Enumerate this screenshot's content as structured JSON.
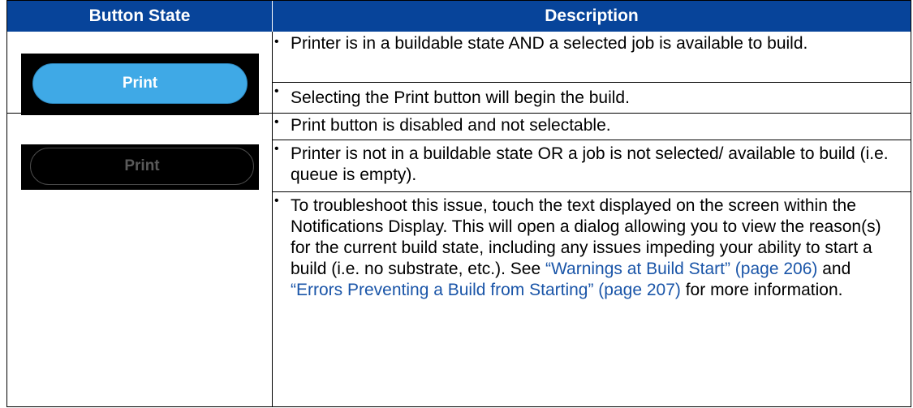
{
  "table": {
    "headers": {
      "state": "Button State",
      "description": "Description"
    },
    "rows": [
      {
        "button": {
          "label": "Print",
          "state": "enabled",
          "color": "#3fa9e6"
        },
        "bullets": [
          "Printer is in a buildable state AND a selected job is available to build.",
          "Selecting the Print button will begin the build."
        ]
      },
      {
        "button": {
          "label": "Print",
          "state": "disabled",
          "color": "#5a5a5a"
        },
        "bullets": [
          "Print button is disabled and not selectable.",
          "Printer is not in a buildable state OR a job is not selected/ available to build (i.e. queue is empty).",
          {
            "text_1": "To troubleshoot this issue, touch the text displayed on the screen within the Notifications Display. This will open a dialog allowing you to view the reason(s) for the current build state, including any issues impeding your ability to start a build (i.e. no substrate, etc.). See ",
            "link_1": "“Warnings at Build Start” (page 206)",
            "text_2": " and ",
            "link_2": "“Errors Preventing a Build from Starting” (page 207)",
            "text_3": " for more information."
          }
        ]
      }
    ],
    "bullet_glyph": "•"
  },
  "colors": {
    "header_bg": "#07449a",
    "link": "#1a55a8"
  }
}
